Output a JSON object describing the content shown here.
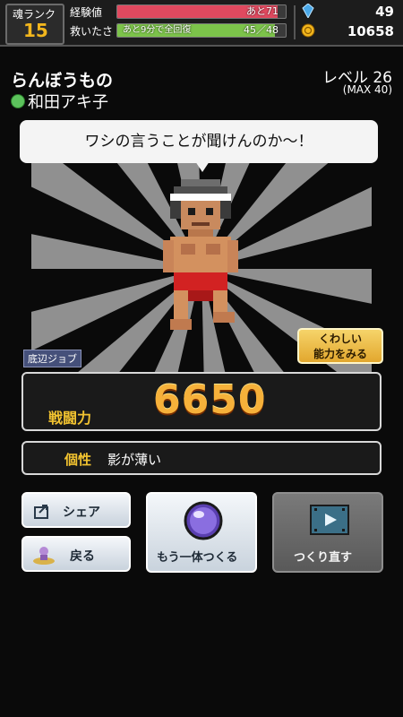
{
  "header": {
    "rank_label": "魂ランク",
    "rank_value": "15",
    "exp_label": "経験値",
    "exp_text": "あと71",
    "exp_fill": 0.95,
    "rescue_label": "救いたさ",
    "rescue_text": "45／48",
    "rescue_note": "あと9分で全回復",
    "rescue_fill": 0.9375,
    "gems": "49",
    "coins": "10658",
    "colors": {
      "exp": "#e0495f",
      "rescue": "#7cc34a",
      "gem": "#4aa8e8",
      "coin": "#f2b61d"
    }
  },
  "character": {
    "name": "らんぼうもの",
    "owner": "和田アキ子",
    "level_label": "レベル 26",
    "level_max": "(MAX 40)",
    "speech": "ワシの言うことが聞けんのか～！",
    "job": "底辺ジョブ"
  },
  "buttons": {
    "details_line1": "くわしい",
    "details_line2": "能力をみる",
    "share": "シェア",
    "back": "戻る",
    "make_another": "もう一体つくる",
    "redo": "つくり直す"
  },
  "stats": {
    "power_label": "戦闘力",
    "power_value": "6650",
    "trait_label": "個性",
    "trait_value": "影が薄い"
  },
  "icons": {
    "gem": "gem-icon",
    "coin": "coin-icon",
    "share": "share-icon",
    "back": "back-icon",
    "orb": "orb-icon",
    "video": "video-icon"
  }
}
